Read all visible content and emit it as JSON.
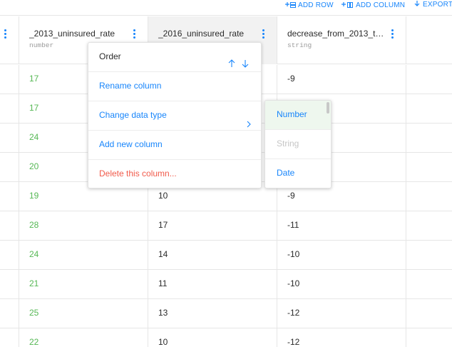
{
  "toolbar": {
    "add_row": "ADD ROW",
    "add_column": "ADD COLUMN",
    "export": "EXPORT"
  },
  "columns": [
    {
      "name": "",
      "type": ""
    },
    {
      "name": "_2013_uninsured_rate",
      "type": "number"
    },
    {
      "name": "_2016_uninsured_rate",
      "type": ""
    },
    {
      "name": "decrease_from_2013_t…",
      "type": "string"
    }
  ],
  "rows": [
    {
      "c2013": "17",
      "c2016": "",
      "decrease": "-9"
    },
    {
      "c2013": "17",
      "c2016": "",
      "decrease": ""
    },
    {
      "c2013": "24",
      "c2016": "",
      "decrease": ""
    },
    {
      "c2013": "20",
      "c2016": "",
      "decrease": ""
    },
    {
      "c2013": "19",
      "c2016": "10",
      "decrease": "-9"
    },
    {
      "c2013": "28",
      "c2016": "17",
      "decrease": "-11"
    },
    {
      "c2013": "24",
      "c2016": "14",
      "decrease": "-10"
    },
    {
      "c2013": "21",
      "c2016": "11",
      "decrease": "-10"
    },
    {
      "c2013": "25",
      "c2016": "13",
      "decrease": "-12"
    },
    {
      "c2013": "22",
      "c2016": "10",
      "decrease": "-12"
    }
  ],
  "context_menu": {
    "order": "Order",
    "rename": "Rename column",
    "change_type": "Change data type",
    "add_column": "Add new column",
    "delete": "Delete this column..."
  },
  "type_submenu": {
    "options": [
      "Number",
      "String",
      "Date"
    ],
    "selected": "Number",
    "disabled": "String"
  },
  "colors": {
    "accent": "#1785fb",
    "number_value": "#56b855",
    "danger": "#f15b4b",
    "active_header": "#f2f2f2"
  }
}
